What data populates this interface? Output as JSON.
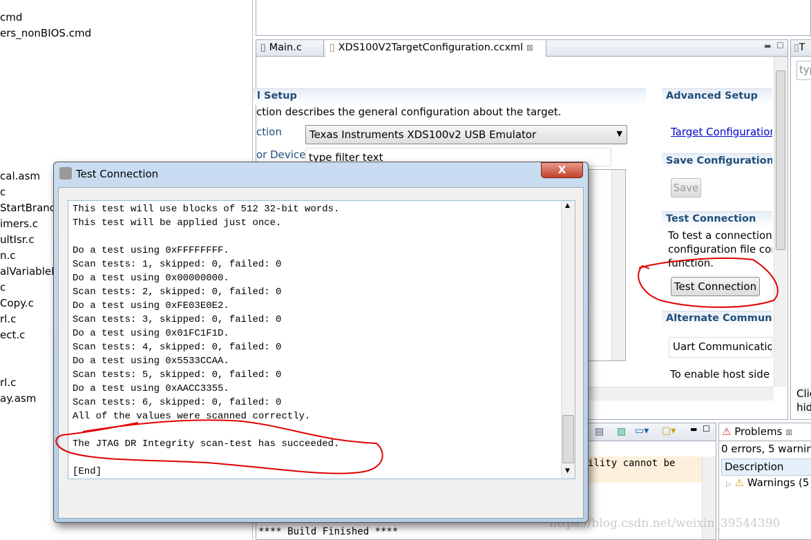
{
  "project_tree": [
    "cmd",
    "ers_nonBIOS.cmd",
    "cal.asm",
    "c",
    "StartBranc",
    "imers.c",
    "ultIsr.c",
    "n.c",
    "alVariableD",
    "c",
    "Copy.c",
    "rl.c",
    "ect.c",
    "rl.c",
    "ay.asm"
  ],
  "editor": {
    "tabs": [
      {
        "label": "Main.c"
      },
      {
        "label": "XDS100V2TargetConfiguration.ccxml"
      }
    ],
    "general_setup": {
      "header": "l Setup",
      "description": "ction describes the general configuration about the target.",
      "connection_label": "ction",
      "connection_value": "Texas Instruments XDS100v2 USB Emulator",
      "device_label": "or Device",
      "filter_placeholder": "type filter text"
    },
    "advanced": {
      "header": "Advanced Setup",
      "link": "Target Configuration"
    },
    "save": {
      "header": "Save Configuration",
      "button": "Save"
    },
    "test": {
      "header": "Test Connection",
      "lines": [
        "To test a connection,",
        "configuration file cor",
        "function."
      ],
      "button": "Test Connection"
    },
    "alternate": {
      "header": "Alternate Communic",
      "uart": "Uart Communicatior",
      "text": "To enable host side"
    }
  },
  "right_panel": {
    "tab": "T",
    "filter": "typ",
    "hint1": "Clic",
    "hint2": "hid"
  },
  "console": {
    "partial": "ility cannot be",
    "build": "**** Build Finished ****"
  },
  "problems": {
    "tab": "Problems",
    "summary": "0 errors, 5 warning",
    "column": "Description",
    "warnings": "Warnings (5"
  },
  "dialog": {
    "title": "Test Connection",
    "lines": [
      "This test will use blocks of 512 32-bit words.",
      "This test will be applied just once.",
      "",
      "Do a test using 0xFFFFFFFF.",
      "Scan tests: 1, skipped: 0, failed: 0",
      "Do a test using 0x00000000.",
      "Scan tests: 2, skipped: 0, failed: 0",
      "Do a test using 0xFE03E0E2.",
      "Scan tests: 3, skipped: 0, failed: 0",
      "Do a test using 0x01FC1F1D.",
      "Scan tests: 4, skipped: 0, failed: 0",
      "Do a test using 0x5533CCAA.",
      "Scan tests: 5, skipped: 0, failed: 0",
      "Do a test using 0xAACC3355.",
      "Scan tests: 6, skipped: 0, failed: 0",
      "All of the values were scanned correctly.",
      "",
      "The JTAG DR Integrity scan-test has succeeded.",
      "",
      "[End]"
    ]
  },
  "watermark": "https://blog.csdn.net/weixin_39544390",
  "colors": {
    "header_text": "#1f4e79",
    "annotation": "#e00000",
    "link": "#0000cc"
  }
}
